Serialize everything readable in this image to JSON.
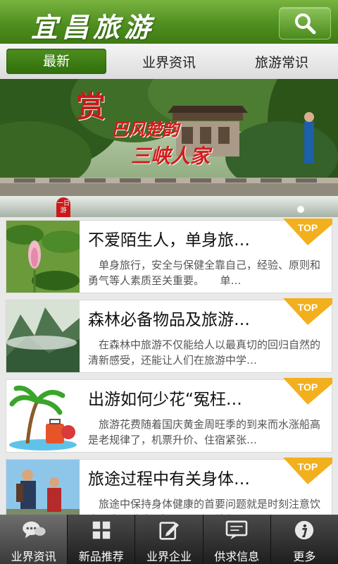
{
  "header": {
    "title": "宜昌旅游"
  },
  "tabs": [
    {
      "label": "最新",
      "active": true
    },
    {
      "label": "业界资讯",
      "active": false
    },
    {
      "label": "旅游常识",
      "active": false
    }
  ],
  "banner": {
    "big_char": "赏",
    "line1": "巴风楚韵",
    "line2": "三峡人家",
    "seal": "一日游"
  },
  "articles": [
    {
      "title": "不爱陌生人，单身旅…",
      "desc": "单身旅行，安全与保健全靠自己，经验、原则和勇气等人素质至关重要。　　单…",
      "badge": "TOP"
    },
    {
      "title": "森林必备物品及旅游…",
      "desc": "在森林中旅游不仅能给人以最真切的回归自然的清新感受，还能让人们在旅游中学…",
      "badge": "TOP"
    },
    {
      "title": "出游如何少花“冤枉…",
      "desc": "旅游花费随着国庆黄金周旺季的到来而水涨船高是老规律了，机票升价、住宿紧张…",
      "badge": "TOP"
    },
    {
      "title": "旅途过程中有关身体…",
      "desc": "旅途中保持身体健康的首要问题就是时刻注意饮食卫生，防止“病从口入”。旅行…",
      "badge": "TOP"
    }
  ],
  "bottom_nav": [
    {
      "label": "业界资讯",
      "icon": "chat-bubbles-icon",
      "active": true
    },
    {
      "label": "新品推荐",
      "icon": "grid-icon",
      "active": false
    },
    {
      "label": "业界企业",
      "icon": "edit-icon",
      "active": false
    },
    {
      "label": "供求信息",
      "icon": "message-box-icon",
      "active": false
    },
    {
      "label": "更多",
      "icon": "info-icon",
      "active": false
    }
  ]
}
